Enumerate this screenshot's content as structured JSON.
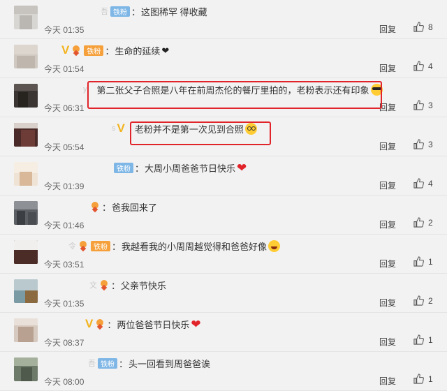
{
  "comments": [
    {
      "name": "吾",
      "text": "这图稀罕 得收藏",
      "time": "今天 01:35",
      "reply": "回复",
      "likes": "8"
    },
    {
      "name": "",
      "text": "生命的延续",
      "time": "今天 01:54",
      "reply": "回复",
      "likes": "4"
    },
    {
      "name": "y",
      "text": "第二张父子合照是八年在前周杰伦的餐厅里拍的，老粉表示还有印象",
      "time": "今天 06:31",
      "reply": "回复",
      "likes": "3"
    },
    {
      "name": "s",
      "text": "老粉并不是第一次见到合照",
      "time": "今天 05:54",
      "reply": "回复",
      "likes": "3"
    },
    {
      "name": "",
      "text": "大周小周爸爸节日快乐",
      "time": "今天 01:39",
      "reply": "回复",
      "likes": "4"
    },
    {
      "name": "",
      "text": "爸我回来了",
      "time": "今天 01:46",
      "reply": "回复",
      "likes": "2"
    },
    {
      "name": "令",
      "text": "我越看我的小周周越觉得和爸爸好像",
      "time": "今天 03:51",
      "reply": "回复",
      "likes": "1"
    },
    {
      "name": "文",
      "text": "父亲节快乐",
      "time": "今天 01:35",
      "reply": "回复",
      "likes": "2"
    },
    {
      "name": "",
      "text": "两位爸爸节日快乐",
      "time": "今天 08:37",
      "reply": "回复",
      "likes": "1"
    },
    {
      "name": "吾",
      "text": "头一回看到周爸爸诶",
      "time": "今天 08:00",
      "reply": "回复",
      "likes": "1"
    }
  ],
  "badges": {
    "fan_label": "铁粉",
    "v_label": "V"
  },
  "icons": {
    "like": "thumbs-up-icon",
    "v": "verified-v-icon",
    "medal": "fan-medal-icon"
  },
  "colors": {
    "highlight": "#e1242a",
    "fan_blue": "#7eb6e6",
    "fan_orange": "#f5a03a",
    "v_gold": "#f2b31e",
    "background": "#f2f2f2"
  }
}
